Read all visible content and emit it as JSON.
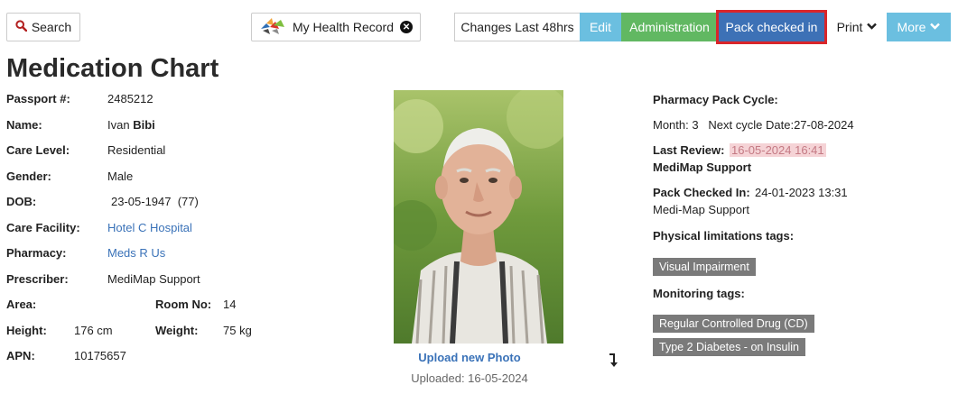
{
  "toolbar": {
    "search_label": "Search",
    "health_record_label": "My Health Record",
    "changes_label": "Changes Last 48hrs",
    "edit_label": "Edit",
    "administration_label": "Administration",
    "pack_checked_label": "Pack checked in",
    "print_label": "Print",
    "more_label": "More"
  },
  "page_title": "Medication Chart",
  "patient": {
    "passport_label": "Passport #:",
    "passport_value": "2485212",
    "name_label": "Name:",
    "first_name": "Ivan",
    "last_name": "Bibi",
    "care_level_label": "Care Level:",
    "care_level_value": "Residential",
    "gender_label": "Gender:",
    "gender_value": "Male",
    "dob_label": "DOB:",
    "dob_value": "23-05-1947  (77)",
    "facility_label": "Care Facility:",
    "facility_value": "Hotel C Hospital",
    "pharmacy_label": "Pharmacy:",
    "pharmacy_value": "Meds R Us",
    "prescriber_label": "Prescriber:",
    "prescriber_value": "MediMap Support",
    "area_label": "Area:",
    "room_label": "Room No:",
    "room_value": "14",
    "height_label": "Height:",
    "height_value": "176 cm",
    "weight_label": "Weight:",
    "weight_value": "75 kg",
    "apn_label": "APN:",
    "apn_value": "10175657"
  },
  "photo": {
    "upload_label": "Upload new Photo",
    "uploaded_text": "Uploaded: 16-05-2024"
  },
  "pharmacy_info": {
    "pack_cycle_label": "Pharmacy Pack Cycle:",
    "cycle_text": "Month: 3   Next cycle Date:27-08-2024",
    "last_review_label": "Last Review:",
    "last_review_value": "16-05-2024 16:41",
    "last_review_by": "MediMap Support",
    "pack_checked_label": "Pack Checked In:",
    "pack_checked_value": "24-01-2023 13:31",
    "pack_checked_by": "Medi-Map Support",
    "physical_tags_label": "Physical limitations tags:",
    "physical_tags": [
      "Visual Impairment"
    ],
    "monitoring_tags_label": "Monitoring tags:",
    "monitoring_tags": [
      "Regular Controlled Drug (CD)",
      "Type 2 Diabetes - on Insulin"
    ]
  },
  "icons": {
    "search": "search-icon",
    "close": "close-icon",
    "chevron": "chevron-down-icon",
    "arrow": "return-arrow-icon"
  },
  "colors": {
    "edit": "#6bbfe0",
    "administration": "#61b862",
    "pack_checked": "#3d71b6",
    "highlight_border": "#d9252a",
    "link": "#3a72b8",
    "tag": "#7a7a7a"
  }
}
